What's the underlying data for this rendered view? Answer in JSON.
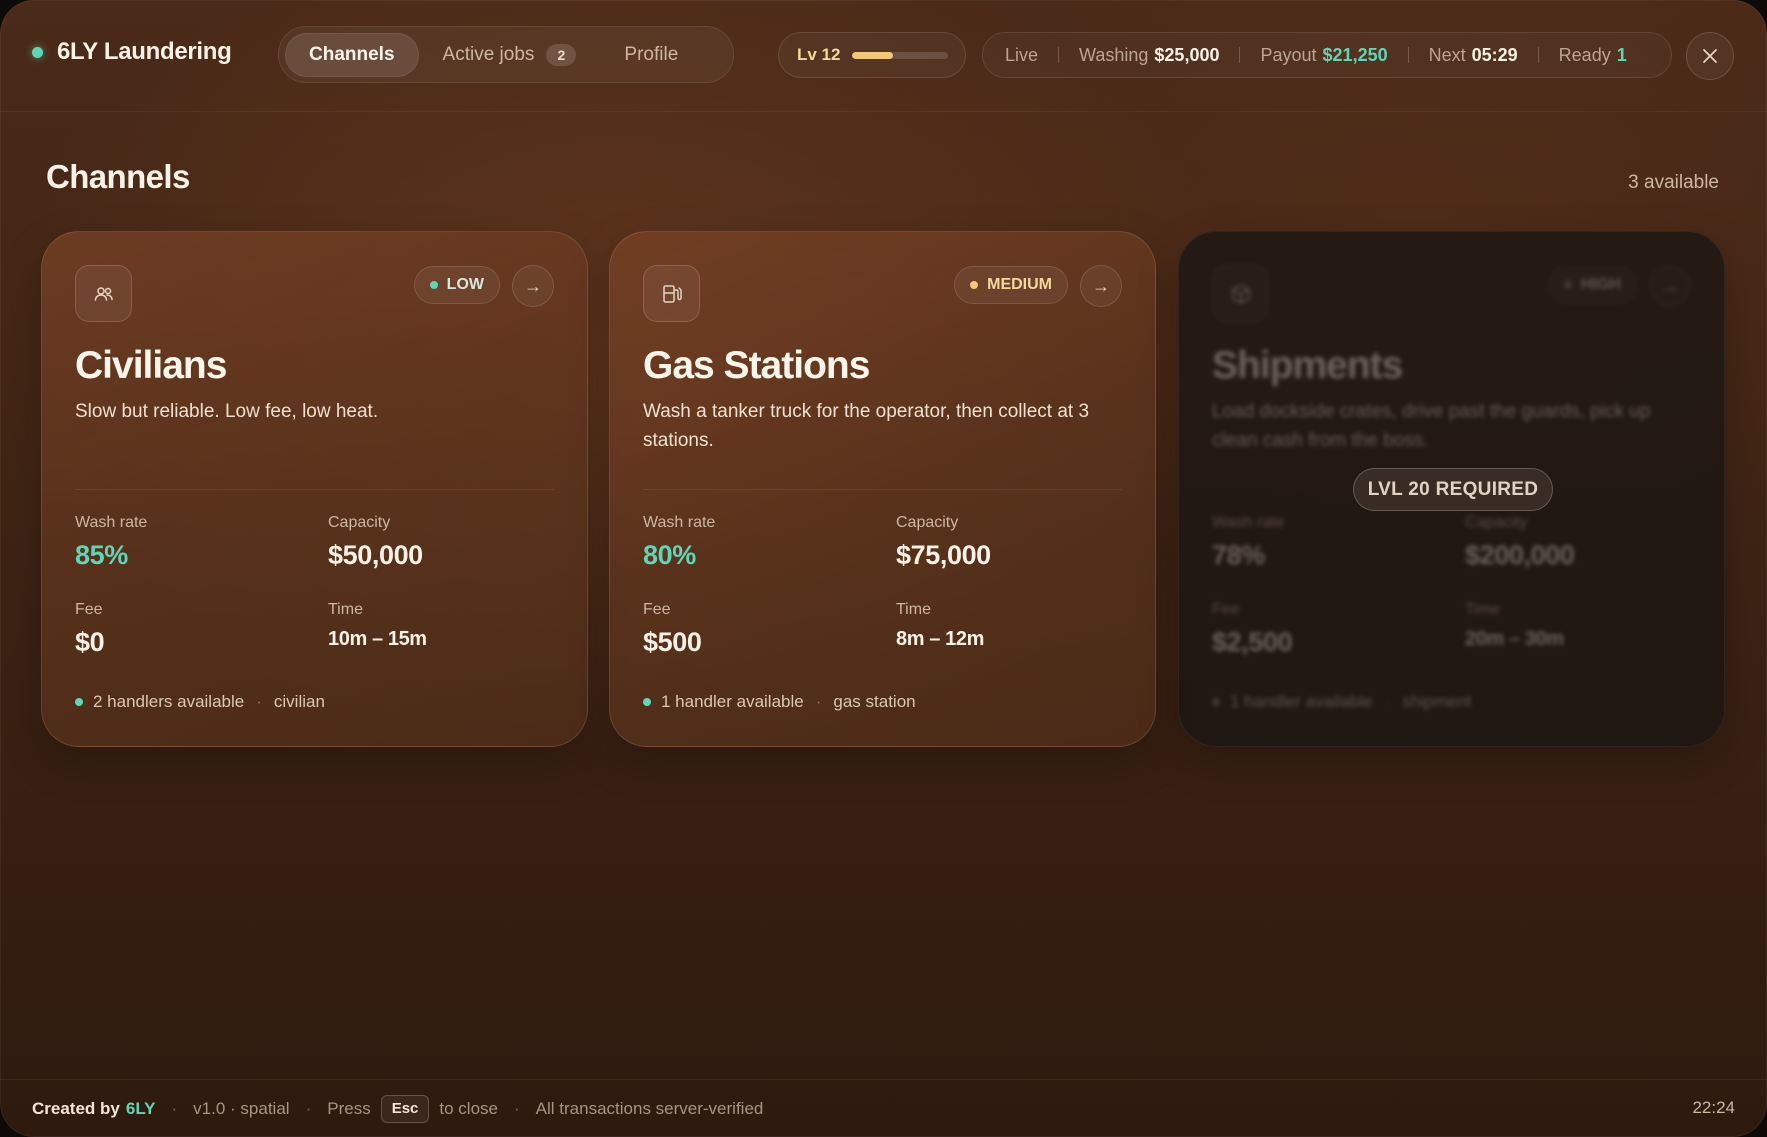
{
  "app": {
    "title": "6LY Laundering"
  },
  "tabs": [
    {
      "label": "Channels",
      "active": true
    },
    {
      "label": "Active jobs",
      "badge": "2"
    },
    {
      "label": "Profile"
    }
  ],
  "level": {
    "label": "Lv 12",
    "progress": 0.42
  },
  "stats": {
    "live_label": "Live",
    "washing_label": "Washing",
    "washing_value": "$25,000",
    "payout_label": "Payout",
    "payout_value": "$21,250",
    "next_label": "Next",
    "next_value": "05:29",
    "ready_label": "Ready",
    "ready_value": "1"
  },
  "section": {
    "title": "Channels",
    "count": "3 available"
  },
  "labels": {
    "wash_rate": "Wash rate",
    "capacity": "Capacity",
    "fee": "Fee",
    "time": "Time"
  },
  "cards": [
    {
      "name": "Civilians",
      "icon": "users-icon",
      "heat": "LOW",
      "heat_color": "#5fd6b8",
      "desc": "Slow but reliable. Low fee, low heat.",
      "wash_rate": "85%",
      "capacity": "$50,000",
      "fee": "$0",
      "time": "10m – 15m",
      "handlers": "2 handlers available",
      "tag": "civilian",
      "locked": false
    },
    {
      "name": "Gas Stations",
      "icon": "fuel-pump-icon",
      "heat": "MEDIUM",
      "heat_color": "#f2c97a",
      "desc": "Wash a tanker truck for the operator, then collect at 3 stations.",
      "wash_rate": "80%",
      "capacity": "$75,000",
      "fee": "$500",
      "time": "8m – 12m",
      "handlers": "1 handler available",
      "tag": "gas station",
      "locked": false
    },
    {
      "name": "Shipments",
      "icon": "box-icon",
      "heat": "HIGH",
      "heat_color": "#8a7a70",
      "desc": "Load dockside crates, drive past the guards, pick up clean cash from the boss.",
      "wash_rate": "78%",
      "capacity": "$200,000",
      "fee": "$2,500",
      "time": "20m – 30m",
      "handlers": "1 handler available",
      "tag": "shipment",
      "locked": true,
      "requirement": "LVL 20 REQUIRED"
    }
  ],
  "footer": {
    "created_by": "Created by",
    "author": "6LY",
    "version": "v1.0 · spatial",
    "press": "Press",
    "key": "Esc",
    "to_close": "to close",
    "verified": "All transactions server-verified",
    "clock": "22:24"
  },
  "colors": {
    "accent_green": "#5fd6b8",
    "accent_gold": "#f2c97a",
    "background": "#3f2414"
  }
}
